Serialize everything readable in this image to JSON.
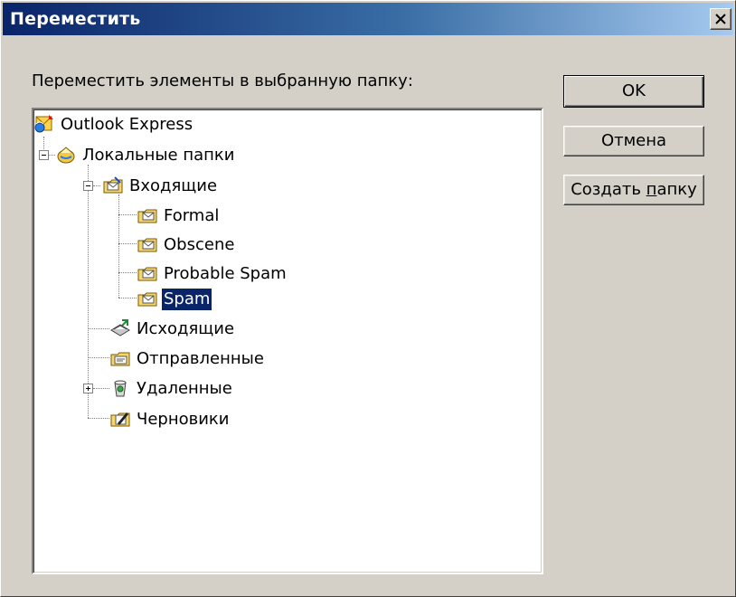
{
  "window": {
    "title": "Переместить"
  },
  "dialog": {
    "prompt": "Переместить элементы в выбранную папку:",
    "buttons": {
      "ok": "OK",
      "cancel": "Отмена",
      "new_folder_prefix": "Создать ",
      "new_folder_accel": "п",
      "new_folder_rest": "апку"
    }
  },
  "tree": {
    "root": "Outlook Express",
    "local_folders": "Локальные папки",
    "inbox": "Входящие",
    "formal": "Formal",
    "obscene": "Obscene",
    "probable_spam": "Probable Spam",
    "spam": "Spam",
    "outbox": "Исходящие",
    "sent": "Отправленные",
    "deleted": "Удаленные",
    "drafts": "Черновики",
    "selected": "Spam"
  }
}
